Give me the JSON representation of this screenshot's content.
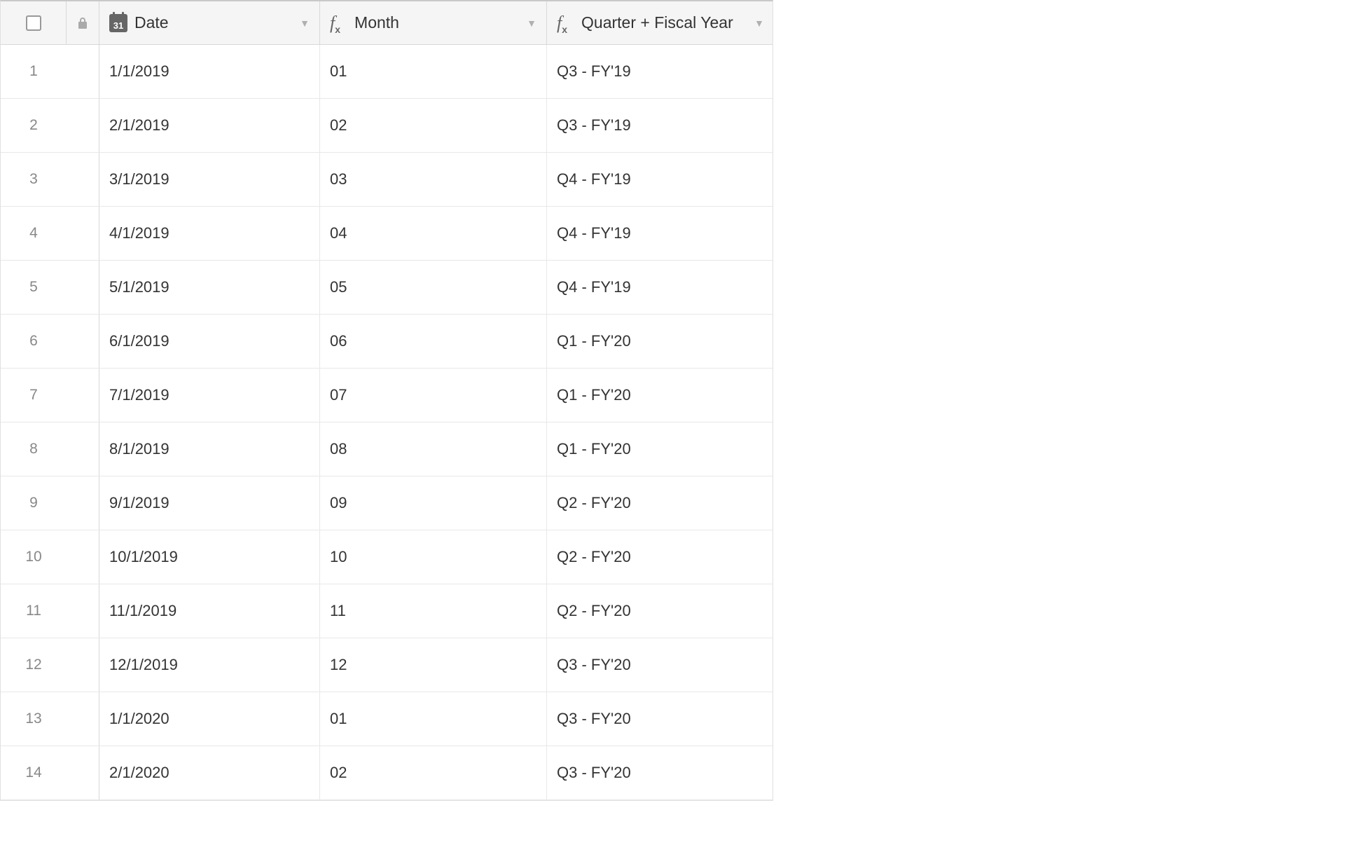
{
  "columns": {
    "date": {
      "label": "Date",
      "icon_text": "31"
    },
    "month": {
      "label": "Month"
    },
    "quarter": {
      "label": "Quarter + Fiscal Year"
    }
  },
  "rows": [
    {
      "num": "1",
      "date": "1/1/2019",
      "month": "01",
      "quarter": "Q3 - FY'19"
    },
    {
      "num": "2",
      "date": "2/1/2019",
      "month": "02",
      "quarter": "Q3 - FY'19"
    },
    {
      "num": "3",
      "date": "3/1/2019",
      "month": "03",
      "quarter": "Q4 - FY'19"
    },
    {
      "num": "4",
      "date": "4/1/2019",
      "month": "04",
      "quarter": "Q4 - FY'19"
    },
    {
      "num": "5",
      "date": "5/1/2019",
      "month": "05",
      "quarter": "Q4 - FY'19"
    },
    {
      "num": "6",
      "date": "6/1/2019",
      "month": "06",
      "quarter": "Q1 - FY'20"
    },
    {
      "num": "7",
      "date": "7/1/2019",
      "month": "07",
      "quarter": "Q1 - FY'20"
    },
    {
      "num": "8",
      "date": "8/1/2019",
      "month": "08",
      "quarter": "Q1 - FY'20"
    },
    {
      "num": "9",
      "date": "9/1/2019",
      "month": "09",
      "quarter": "Q2 - FY'20"
    },
    {
      "num": "10",
      "date": "10/1/2019",
      "month": "10",
      "quarter": "Q2 - FY'20"
    },
    {
      "num": "11",
      "date": "11/1/2019",
      "month": "11",
      "quarter": "Q2 - FY'20"
    },
    {
      "num": "12",
      "date": "12/1/2019",
      "month": "12",
      "quarter": "Q3 - FY'20"
    },
    {
      "num": "13",
      "date": "1/1/2020",
      "month": "01",
      "quarter": "Q3 - FY'20"
    },
    {
      "num": "14",
      "date": "2/1/2020",
      "month": "02",
      "quarter": "Q3 - FY'20"
    }
  ]
}
